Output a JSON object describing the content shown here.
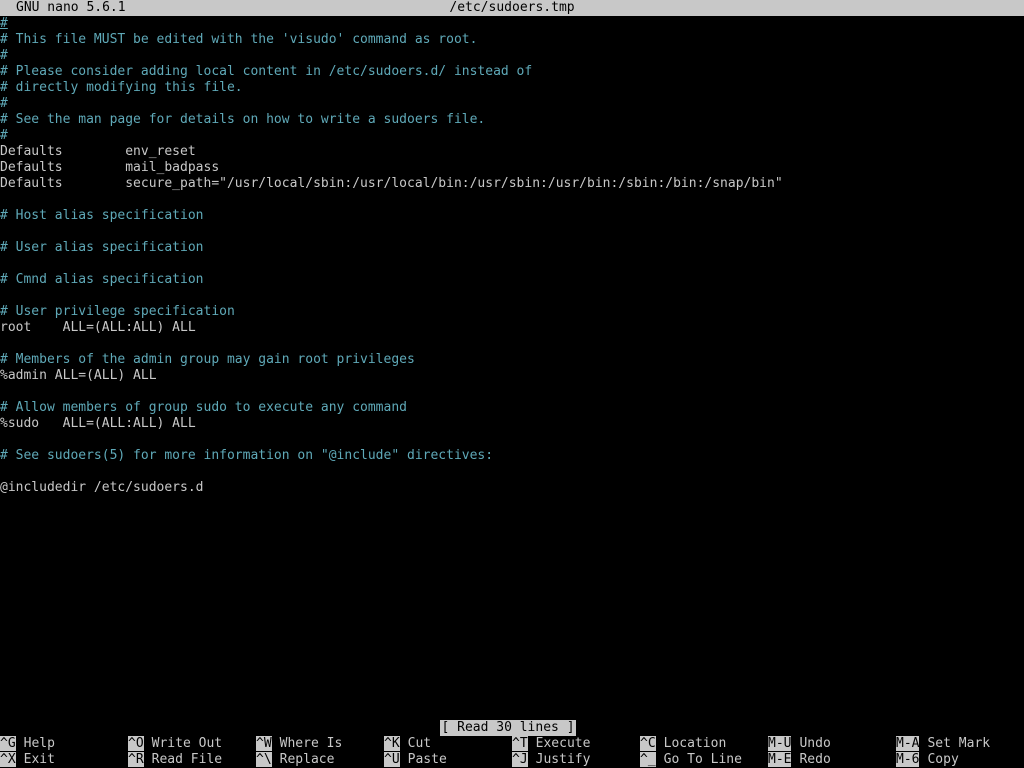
{
  "titlebar": {
    "program": "GNU nano 5.6.1",
    "filename": "/etc/sudoers.tmp"
  },
  "lines": [
    {
      "text": "#",
      "type": "comment"
    },
    {
      "text": "# This file MUST be edited with the 'visudo' command as root.",
      "type": "comment"
    },
    {
      "text": "#",
      "type": "comment"
    },
    {
      "text": "# Please consider adding local content in /etc/sudoers.d/ instead of",
      "type": "comment"
    },
    {
      "text": "# directly modifying this file.",
      "type": "comment"
    },
    {
      "text": "#",
      "type": "comment"
    },
    {
      "text": "# See the man page for details on how to write a sudoers file.",
      "type": "comment"
    },
    {
      "text": "#",
      "type": "comment"
    },
    {
      "text": "Defaults        env_reset",
      "type": "plain"
    },
    {
      "text": "Defaults        mail_badpass",
      "type": "plain"
    },
    {
      "text": "Defaults        secure_path=\"/usr/local/sbin:/usr/local/bin:/usr/sbin:/usr/bin:/sbin:/bin:/snap/bin\"",
      "type": "plain"
    },
    {
      "text": "",
      "type": "plain"
    },
    {
      "text": "# Host alias specification",
      "type": "comment"
    },
    {
      "text": "",
      "type": "plain"
    },
    {
      "text": "# User alias specification",
      "type": "comment"
    },
    {
      "text": "",
      "type": "plain"
    },
    {
      "text": "# Cmnd alias specification",
      "type": "comment"
    },
    {
      "text": "",
      "type": "plain"
    },
    {
      "text": "# User privilege specification",
      "type": "comment"
    },
    {
      "text": "root    ALL=(ALL:ALL) ALL",
      "type": "plain"
    },
    {
      "text": "",
      "type": "plain"
    },
    {
      "text": "# Members of the admin group may gain root privileges",
      "type": "comment"
    },
    {
      "text": "%admin ALL=(ALL) ALL",
      "type": "plain"
    },
    {
      "text": "",
      "type": "plain"
    },
    {
      "text": "# Allow members of group sudo to execute any command",
      "type": "comment"
    },
    {
      "text": "%sudo   ALL=(ALL:ALL) ALL",
      "type": "plain"
    },
    {
      "text": "",
      "type": "plain"
    },
    {
      "text": "# See sudoers(5) for more information on \"@include\" directives:",
      "type": "comment"
    },
    {
      "text": "",
      "type": "plain"
    },
    {
      "text": "@includedir /etc/sudoers.d",
      "type": "plain"
    }
  ],
  "status_message": "[ Read 30 lines ]",
  "shortcuts": [
    {
      "key": "^G",
      "label": "Help",
      "name": "help"
    },
    {
      "key": "^X",
      "label": "Exit",
      "name": "exit"
    },
    {
      "key": "^O",
      "label": "Write Out",
      "name": "write-out"
    },
    {
      "key": "^R",
      "label": "Read File",
      "name": "read-file"
    },
    {
      "key": "^W",
      "label": "Where Is",
      "name": "where-is"
    },
    {
      "key": "^\\",
      "label": "Replace",
      "name": "replace"
    },
    {
      "key": "^K",
      "label": "Cut",
      "name": "cut"
    },
    {
      "key": "^U",
      "label": "Paste",
      "name": "paste"
    },
    {
      "key": "^T",
      "label": "Execute",
      "name": "execute"
    },
    {
      "key": "^J",
      "label": "Justify",
      "name": "justify"
    },
    {
      "key": "^C",
      "label": "Location",
      "name": "location"
    },
    {
      "key": "^_",
      "label": "Go To Line",
      "name": "go-to-line"
    },
    {
      "key": "M-U",
      "label": "Undo",
      "name": "undo"
    },
    {
      "key": "M-E",
      "label": "Redo",
      "name": "redo"
    },
    {
      "key": "M-A",
      "label": "Set Mark",
      "name": "set-mark"
    },
    {
      "key": "M-6",
      "label": "Copy",
      "name": "copy"
    }
  ],
  "colors": {
    "comment": "#5fa9b8",
    "plain": "#c8c8c8",
    "bar": "#c8c8c8",
    "background": "#000000"
  }
}
